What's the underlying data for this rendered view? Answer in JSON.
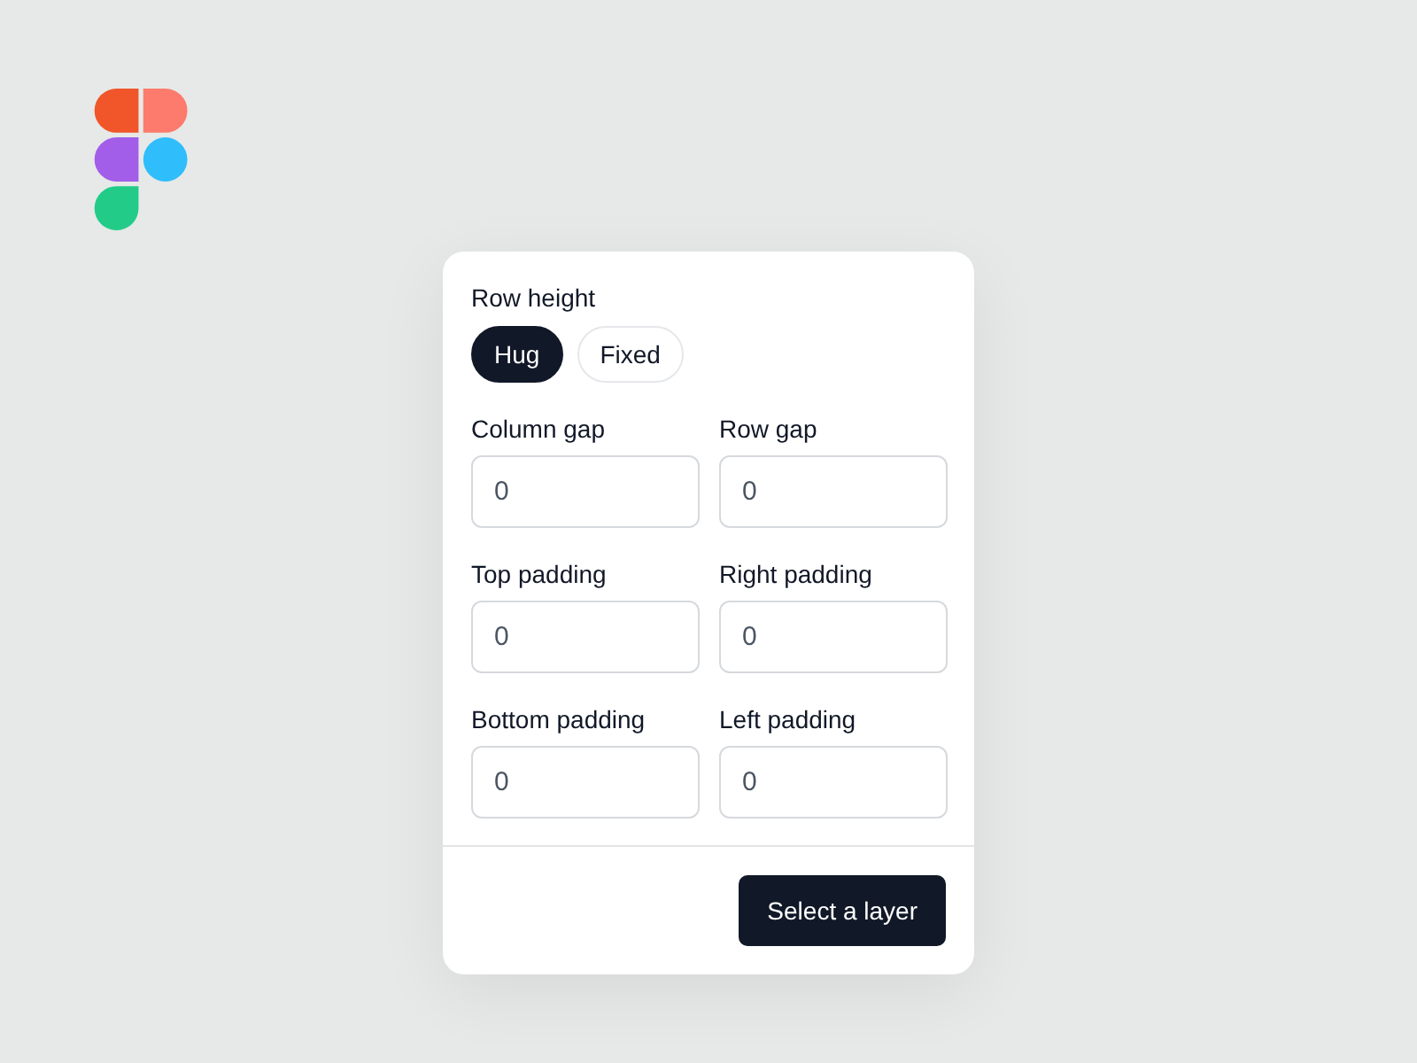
{
  "row_height": {
    "label": "Row height",
    "options": [
      {
        "label": "Hug",
        "selected": true
      },
      {
        "label": "Fixed",
        "selected": false
      }
    ]
  },
  "fields": [
    {
      "label": "Column gap",
      "value": "0"
    },
    {
      "label": "Row gap",
      "value": "0"
    },
    {
      "label": "Top padding",
      "value": "0"
    },
    {
      "label": "Right padding",
      "value": "0"
    },
    {
      "label": "Bottom padding",
      "value": "0"
    },
    {
      "label": "Left padding",
      "value": "0"
    }
  ],
  "button": {
    "label": "Select a layer"
  }
}
